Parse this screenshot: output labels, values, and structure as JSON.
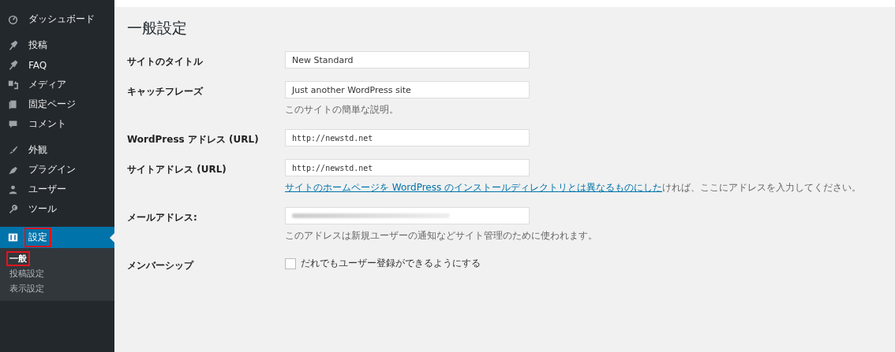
{
  "sidebar": {
    "items": [
      {
        "label": "ダッシュボード",
        "selected": false,
        "highlighted": false
      },
      {
        "label": "投稿",
        "selected": false,
        "highlighted": false
      },
      {
        "label": "FAQ",
        "selected": false,
        "highlighted": false
      },
      {
        "label": "メディア",
        "selected": false,
        "highlighted": false
      },
      {
        "label": "固定ページ",
        "selected": false,
        "highlighted": false
      },
      {
        "label": "コメント",
        "selected": false,
        "highlighted": false
      },
      {
        "label": "外観",
        "selected": false,
        "highlighted": false
      },
      {
        "label": "プラグイン",
        "selected": false,
        "highlighted": false
      },
      {
        "label": "ユーザー",
        "selected": false,
        "highlighted": false
      },
      {
        "label": "ツール",
        "selected": false,
        "highlighted": false
      },
      {
        "label": "設定",
        "selected": true,
        "highlighted": true
      }
    ],
    "submenu": [
      {
        "label": "一般",
        "selected": true,
        "highlighted": true
      },
      {
        "label": "投稿設定",
        "selected": false,
        "highlighted": false
      },
      {
        "label": "表示設定",
        "selected": false,
        "highlighted": false
      }
    ]
  },
  "page_title": "一般設定",
  "rows": [
    {
      "kind": "text",
      "label": "サイトのタイトル",
      "value": "New Standard"
    },
    {
      "kind": "text",
      "label": "キャッチフレーズ",
      "value": "Just another WordPress site",
      "description": "このサイトの簡単な説明。"
    },
    {
      "kind": "url",
      "label": "WordPress アドレス (URL)",
      "value": "http://newstd.net"
    },
    {
      "kind": "url",
      "label": "サイトアドレス (URL)",
      "value": "http://newstd.net",
      "description_link": "サイトのホームページを WordPress のインストールディレクトリとは異なるものにした",
      "description": "ければ、ここにアドレスを入力してください。"
    },
    {
      "kind": "blurred",
      "label": "メールアドレス:",
      "description": "このアドレスは新規ユーザーの通知などサイト管理のために使われます。"
    },
    {
      "kind": "checkbox",
      "label": "メンバーシップ",
      "checked": false,
      "option": "だれでもユーザー登録ができるようにする"
    }
  ]
}
